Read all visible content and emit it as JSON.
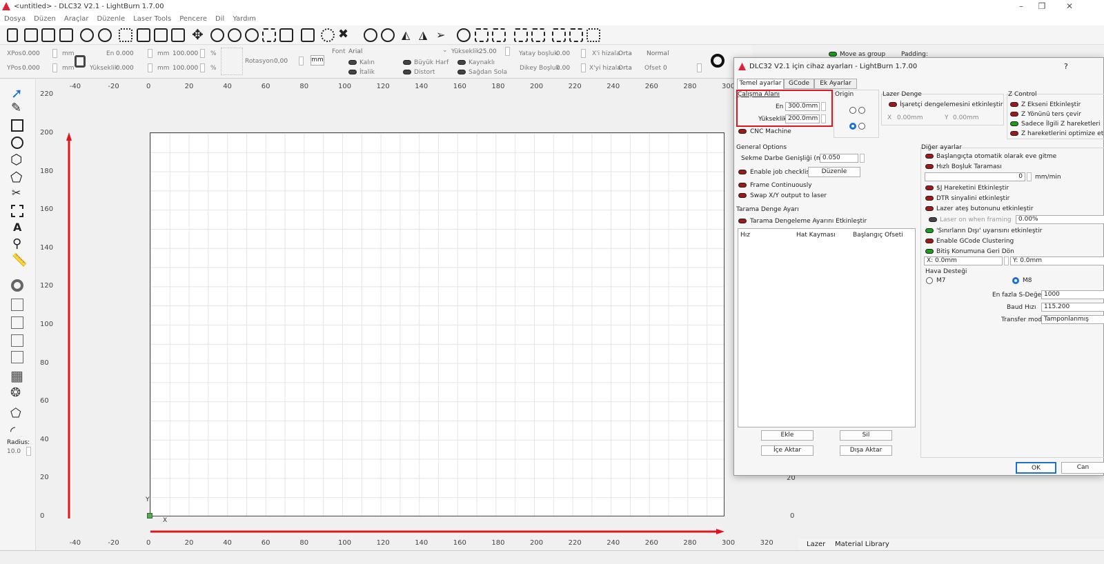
{
  "window": {
    "title": "<untitled> - DLC32 V2.1 - LightBurn 1.7.00"
  },
  "menu": [
    "Dosya",
    "Düzen",
    "Araçlar",
    "Düzenle",
    "Laser Tools",
    "Pencere",
    "Dil",
    "Yardım"
  ],
  "props": {
    "xpos_label": "XPos",
    "xpos": "0.000",
    "ypos_label": "YPos",
    "ypos": "0.000",
    "unit": "mm",
    "width_label": "En",
    "width": "0.000",
    "height_label": "Yükseklik",
    "height": "0.000",
    "scale_w": "100.000",
    "scale_h": "100.000",
    "pct": "%",
    "rotation_label": "Rotasyon",
    "rotation": "0,00",
    "mm_btn": "mm",
    "font_label": "Font",
    "font": "Arial",
    "font_h_label": "Yükseklik",
    "font_h": "25.00",
    "hspace_label": "Yatay boşluk",
    "hspace": "0.00",
    "vspace_label": "Dikey Boşluk",
    "vspace": "0.00",
    "xalign_label": "X'i hizala",
    "xalign": "Orta",
    "yalign_label": "X'yi hizala",
    "yalign": "Orta",
    "normal": "Normal",
    "offset_label": "Ofset",
    "offset": "0",
    "bold": "Kalın",
    "italic": "İtalik",
    "upper": "Büyük Harf",
    "distort": "Distort",
    "welded": "Kaynaklı",
    "rtl": "Sağdan Sola",
    "move_group": "Move as group",
    "padding": "Padding:"
  },
  "rulers": {
    "top": [
      "-40",
      "-20",
      "0",
      "20",
      "40",
      "60",
      "80",
      "100",
      "120",
      "140",
      "160",
      "180",
      "200",
      "220",
      "240",
      "260",
      "280",
      "300"
    ],
    "bottom": [
      "-40",
      "-20",
      "0",
      "20",
      "40",
      "60",
      "80",
      "100",
      "120",
      "140",
      "160",
      "180",
      "200",
      "220",
      "240",
      "260",
      "280",
      "300",
      "320"
    ],
    "left": [
      "220",
      "200",
      "180",
      "160",
      "140",
      "120",
      "100",
      "80",
      "60",
      "40",
      "20",
      "0"
    ],
    "right_0": "0",
    "right_20": "20"
  },
  "axes": {
    "x": "X",
    "y": "Y"
  },
  "left_tools": {
    "radius_label": "Radius:",
    "radius": "10.0"
  },
  "dialog": {
    "title": "DLC32 V2.1 için cihaz ayarları - LightBurn 1.7.00",
    "help": "?",
    "tabs": [
      "Temel ayarlar",
      "GCode",
      "Ek Ayarlar"
    ],
    "work_area": {
      "label": "Çalışma Alanı",
      "w_label": "En",
      "w": "300.0mm",
      "h_label": "Yükseklik",
      "h": "200.0mm"
    },
    "cnc": "CNC Machine",
    "origin": "Origin",
    "laser_offset": {
      "label": "Lazer Denge",
      "enable": "İşaretçi dengelemesini etkinleştir",
      "x_label": "X",
      "x": "0.00mm",
      "y_label": "Y",
      "y": "0.00mm"
    },
    "zcontrol": {
      "label": "Z Control",
      "items": [
        "Z Ekseni Etkinleştir",
        "Z Yönünü ters çevir",
        "Sadece İlgili Z hareketleri",
        "Z hareketlerini optimize et"
      ]
    },
    "general": {
      "label": "General Options",
      "dot_label": "Sekme Darbe Genişliği (mm)",
      "dot": "0.050",
      "checklist": "Enable job checklist",
      "edit": "Düzenle",
      "frame": "Frame Continuously",
      "swap": "Swap X/Y output to laser"
    },
    "scan": {
      "label": "Tarama Denge Ayarı",
      "enable": "Tarama Dengeleme Ayarını Etkinleştir",
      "cols": [
        "Hız",
        "Hat Kayması",
        "Başlangıç Ofseti"
      ],
      "add": "Ekle",
      "del": "Sil",
      "import": "İçe Aktar",
      "export": "Dışa Aktar"
    },
    "other": {
      "label": "Diğer ayarlar",
      "items": [
        "Başlangıçta otomatik olarak eve gitme",
        "Hızlı Boşluk Taraması"
      ],
      "rapid": "0",
      "rapid_unit": "mm/min",
      "items2": [
        "$J Hareketini Etkinleştir",
        "DTR sinyalini etkinleştir",
        "Lazer ateş butonunu etkinleştir"
      ],
      "framing": "Laser on when framing",
      "framing_val": "0.00%",
      "items3": [
        "'Sınırların Dışı' uyarısını etkinleştir",
        "Enable GCode Clustering",
        "Bitiş Konumuna Geri Dön"
      ],
      "ret_x": "X: 0.0mm",
      "ret_y": "Y: 0.0mm",
      "air": "Hava Desteği",
      "m7": "M7",
      "m8": "M8",
      "smax_label": "En fazla S-Değeri",
      "smax": "1000",
      "baud_label": "Baud Hızı",
      "baud": "115.200",
      "transfer_label": "Transfer modu",
      "transfer": "Tamponlanmış"
    },
    "ok": "OK",
    "cancel": "Can"
  },
  "bottom_tabs": [
    "Lazer",
    "Material Library"
  ],
  "colors": {
    "accent": "#1a6fd8",
    "highlight": "#e0141e",
    "arrow": "#e0141e"
  }
}
